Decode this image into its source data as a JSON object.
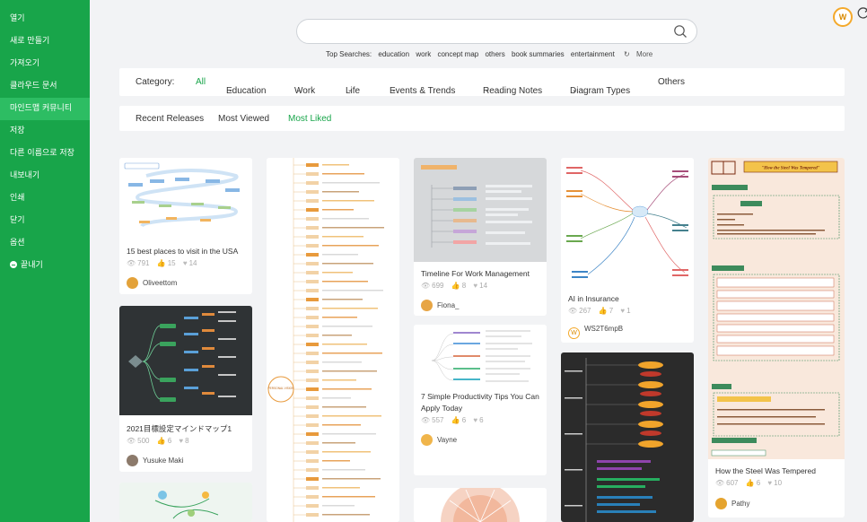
{
  "sidebar": {
    "items": [
      {
        "label": "열기"
      },
      {
        "label": "새로 만들기"
      },
      {
        "label": "가져오기"
      },
      {
        "label": "클라우드 문서"
      },
      {
        "label": "마인드맵 커뮤니티"
      },
      {
        "label": "저장"
      },
      {
        "label": "다른 이름으로 저장"
      },
      {
        "label": "내보내기"
      },
      {
        "label": "인쇄"
      },
      {
        "label": "닫기"
      },
      {
        "label": "옵션"
      },
      {
        "label": "끝내기"
      }
    ],
    "active_index": 4
  },
  "header": {
    "search_placeholder": "",
    "top_searches_label": "Top Searches:",
    "top_searches": [
      "education",
      "work",
      "concept map",
      "others",
      "book summaries",
      "entertainment"
    ],
    "more_label": "More",
    "avatar_initial": "W"
  },
  "categories": {
    "label": "Category:",
    "items": [
      "All",
      "Education",
      "Work",
      "Life",
      "Events & Trends",
      "Reading Notes",
      "Diagram Types",
      "Others"
    ],
    "active": "All"
  },
  "sort": {
    "items": [
      "Recent Releases",
      "Most Viewed",
      "Most Liked"
    ],
    "active": "Most Liked"
  },
  "cards": [
    {
      "title": "15 best places to visit in the USA",
      "views": "791",
      "likes": "15",
      "favorites": "14",
      "author": "Oliveettom"
    },
    {
      "title": "2021目標設定マインドマップ1",
      "views": "500",
      "likes": "6",
      "favorites": "8",
      "author": "Yusuke Maki"
    },
    {
      "title": "Timeline For Work Management",
      "views": "699",
      "likes": "8",
      "favorites": "14",
      "author": "Fiona_"
    },
    {
      "title": "7 Simple Productivity Tips You Can Apply Today",
      "views": "557",
      "likes": "6",
      "favorites": "6",
      "author": "Vayne"
    },
    {
      "title": "AI in Insurance",
      "views": "267",
      "likes": "7",
      "favorites": "1",
      "author": "WS2T6mpB"
    },
    {
      "title": "How the Steel Was Tempered",
      "views": "607",
      "likes": "6",
      "favorites": "10",
      "author": "Pathy"
    }
  ],
  "thumb_texts": {
    "steel_title": "\"How the Steel Was Tempered\"",
    "center_node": "PERSONAL VISION"
  },
  "colors": {
    "brand_green": "#18a54a",
    "active_sidebar": "#2dbd63",
    "accent_orange": "#f4a92b"
  },
  "icons": [
    "search-icon",
    "refresh-icon",
    "eye-icon",
    "thumbs-up-icon",
    "heart-icon",
    "chevron-down-icon",
    "exit-icon"
  ]
}
